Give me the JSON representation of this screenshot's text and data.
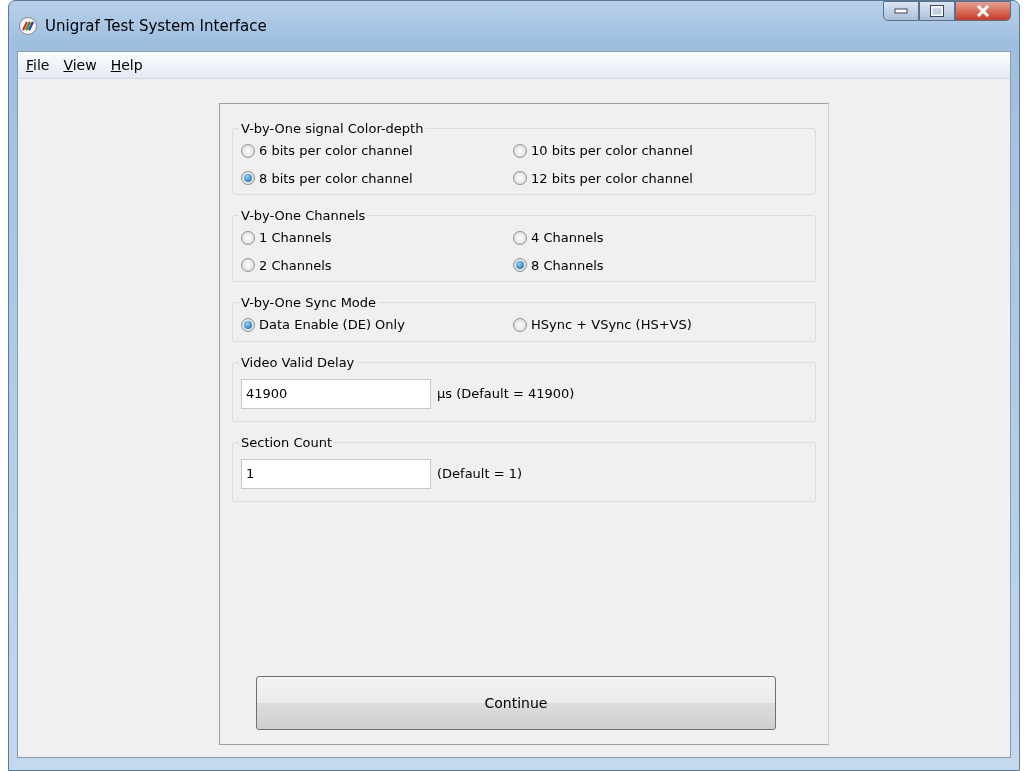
{
  "window": {
    "title": "Unigraf Test System Interface"
  },
  "menu": [
    {
      "label": "File"
    },
    {
      "label": "View"
    },
    {
      "label": "Help"
    }
  ],
  "groups": [
    {
      "kind": "radio",
      "title": "V-by-One signal Color-depth",
      "options": [
        {
          "label": "6 bits per color channel",
          "selected": false
        },
        {
          "label": "10 bits per color channel",
          "selected": false
        },
        {
          "label": "8 bits per color channel",
          "selected": true
        },
        {
          "label": "12 bits per color channel",
          "selected": false
        }
      ]
    },
    {
      "kind": "radio",
      "title": "V-by-One Channels",
      "options": [
        {
          "label": "1 Channels",
          "selected": false
        },
        {
          "label": "4 Channels",
          "selected": false
        },
        {
          "label": "2 Channels",
          "selected": false
        },
        {
          "label": "8 Channels",
          "selected": true
        }
      ]
    },
    {
      "kind": "radio",
      "title": "V-by-One Sync Mode",
      "options": [
        {
          "label": "Data Enable (DE) Only",
          "selected": true
        },
        {
          "label": "HSync + VSync (HS+VS)",
          "selected": false
        }
      ]
    },
    {
      "kind": "input",
      "title": "Video Valid Delay",
      "value": "41900",
      "suffix": "µs (Default = 41900)"
    },
    {
      "kind": "input",
      "title": "Section Count",
      "value": "1",
      "suffix": "(Default = 1)"
    }
  ],
  "continue_button": "Continue"
}
